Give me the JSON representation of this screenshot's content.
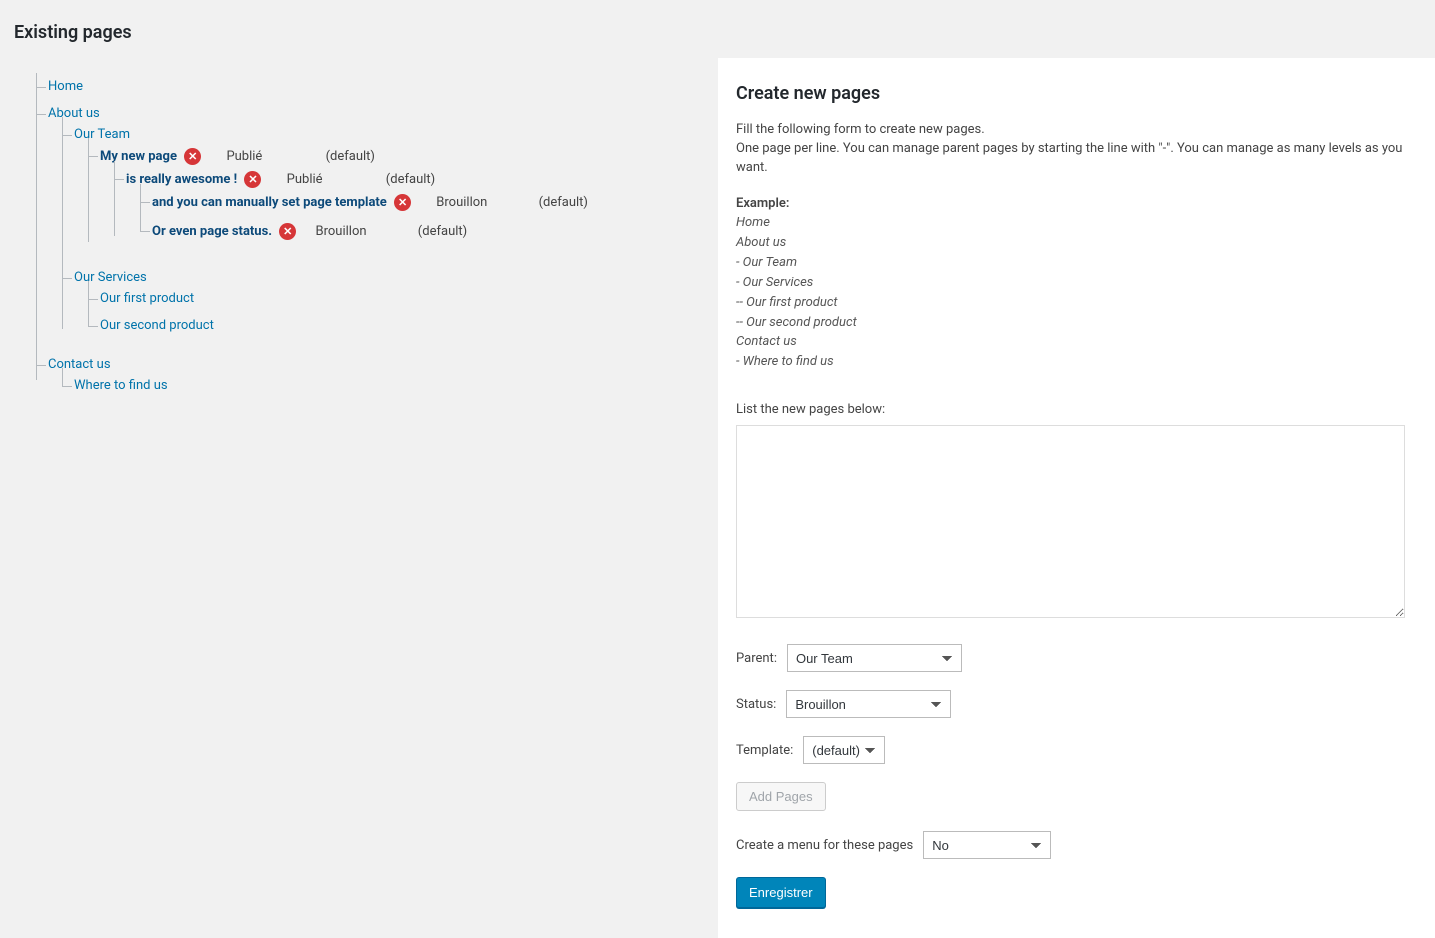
{
  "left": {
    "title": "Existing pages",
    "tree": {
      "home": "Home",
      "about_us": "About us",
      "our_team": "Our Team",
      "my_new_page": {
        "label": "My new page",
        "status": "Publié",
        "template": "(default)"
      },
      "awesome": {
        "label": "is really awesome !",
        "status": "Publié",
        "template": "(default)"
      },
      "manual_tpl": {
        "label": "and you can manually set page template",
        "status": "Brouillon",
        "template": "(default)"
      },
      "page_status": {
        "label": "Or even page status.",
        "status": "Brouillon",
        "template": "(default)"
      },
      "our_services": "Our Services",
      "first_product": "Our first product",
      "second_product": "Our second product",
      "contact_us": "Contact us",
      "where_to_find": "Where to find us"
    }
  },
  "right": {
    "title": "Create new pages",
    "desc1": "Fill the following form to create new pages.",
    "desc2": "One page per line. You can manage parent pages by starting the line with \"-\". You can manage as many levels as you want.",
    "example_label": "Example:",
    "example": [
      "Home",
      "About us",
      "- Our Team",
      "- Our Services",
      "-- Our first product",
      "-- Our second product",
      "Contact us",
      "- Where to find us"
    ],
    "list_label": "List the new pages below:",
    "parent_label": "Parent:",
    "parent_value": "   Our Team",
    "status_label": "Status:",
    "status_value": "Brouillon",
    "template_label": "Template:",
    "template_value": "(default)",
    "add_pages": "Add Pages",
    "menu_label": "Create a menu for these pages",
    "menu_value": "No",
    "submit": "Enregistrer"
  }
}
